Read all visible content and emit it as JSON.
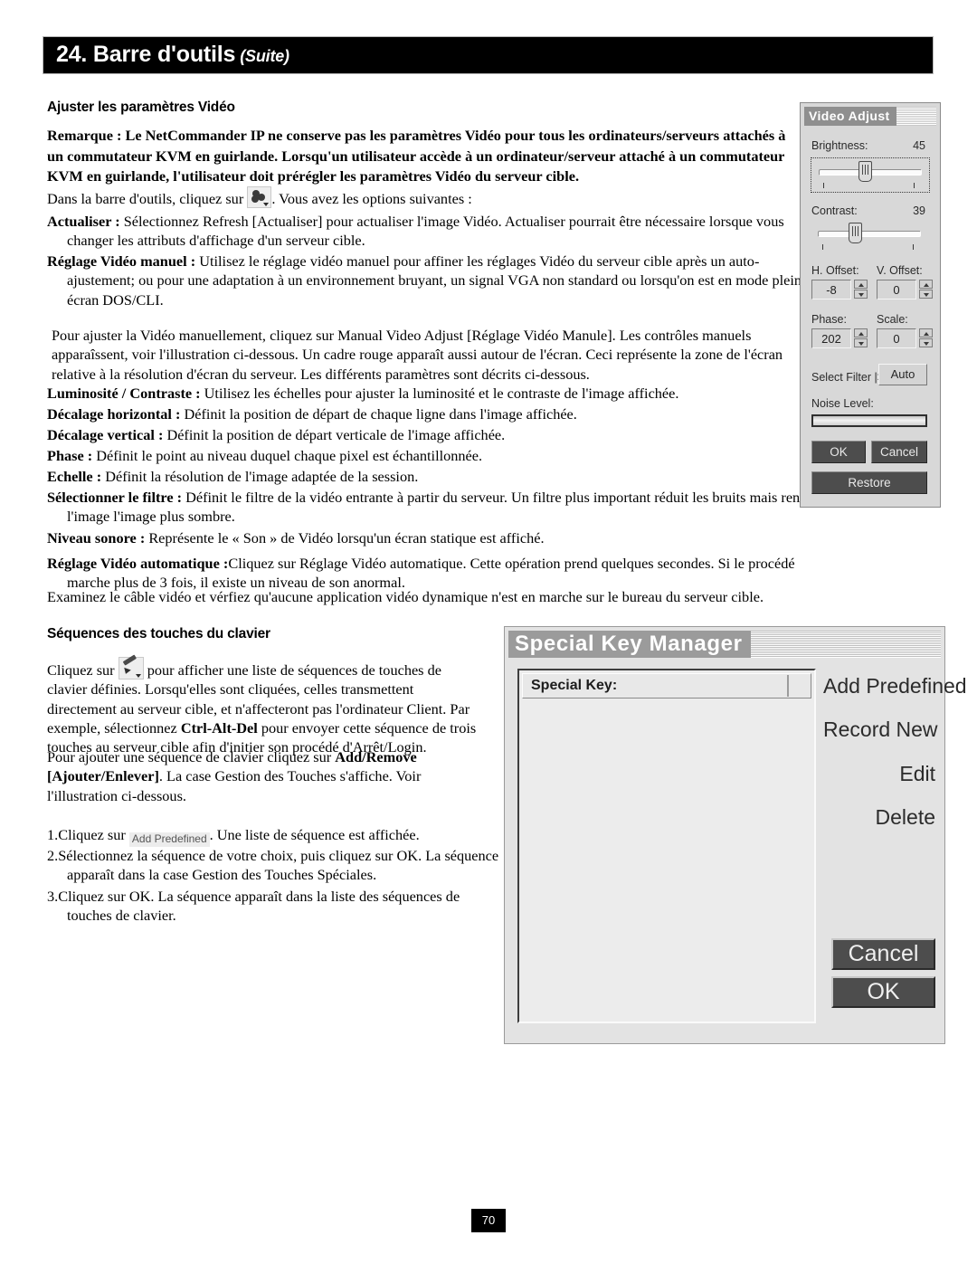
{
  "header": {
    "title": "24. Barre d'outils",
    "suffix": "(Suite)"
  },
  "sections": {
    "video_heading": "Ajuster les paramètres Vidéo",
    "note_label": "Remarque :",
    "note_body": " Le NetCommander IP ne conserve pas les paramètres Vidéo pour tous les ordinateurs/serveurs attachés à un commutateur KVM en guirlande. Lorsqu'un utilisateur accède à un ordinateur/serveur attaché à un commutateur KVM en guirlande, l'utilisateur doit prérégler les paramètres Vidéo du serveur cible.",
    "toolbar_line_pre": "Dans la barre d'outils, cliquez sur ",
    "toolbar_line_post": ". Vous avez les options suivantes :",
    "refresh_label": "Actualiser :",
    "refresh_body": " Sélectionnez Refresh [Actualiser] pour actualiser l'image Vidéo. Actualiser pourrait être nécessaire lorsque vous changer les attributs d'affichage d'un serveur cible.",
    "manual_label": "Réglage Vidéo manuel :",
    "manual_body": " Utilisez le réglage vidéo manuel pour affiner les réglages Vidéo du serveur cible après un auto-ajustement; ou pour une adaptation à un environnement bruyant, un signal VGA non standard ou lorsqu'on est en mode plein écran DOS/CLI.",
    "manual_intro": "Pour ajuster la Vidéo manuellement, cliquez sur Manual Video Adjust [Réglage Vidéo Manule]. Les contrôles manuels apparaîssent, voir l'illustration ci-dessous. Un cadre rouge apparaît aussi autour de l'écran. Ceci représente la zone de l'écran relative à la résolution d'écran du serveur. Les différents paramètres sont décrits ci-dessous.",
    "items": [
      {
        "label": "Luminosité / Contraste :",
        "body": " Utilisez les échelles pour ajuster la luminosité et le contraste de l'image affichée."
      },
      {
        "label": "Décalage horizontal :",
        "body": " Définit la position de départ de chaque ligne dans l'image affichée."
      },
      {
        "label": "Décalage vertical :",
        "body": " Définit la position de départ verticale de l'image affichée."
      },
      {
        "label": "Phase :",
        "body": " Définit le point au niveau duquel chaque pixel est échantillonnée."
      },
      {
        "label": "Echelle :",
        "body": " Définit la résolution de l'image adaptée de la session."
      },
      {
        "label": "Sélectionner le filtre :",
        "body": " Définit le filtre de la vidéo entrante à partir du serveur. Un filtre plus important réduit les bruits mais rend l'image l'image plus sombre."
      },
      {
        "label": "Niveau sonore :",
        "body": " Représente le « Son » de Vidéo lorsqu'un écran statique est affiché."
      },
      {
        "label": "Réglage Vidéo automatique :",
        "body": "Cliquez sur Réglage Vidéo automatique. Cette opération prend quelques secondes. Si le procédé marche plus de 3 fois, il existe un niveau de son anormal."
      }
    ],
    "closing_line": "Examinez le câble vidéo et vérfiez qu'aucune application vidéo dynamique n'est en marche sur le bureau du serveur cible.",
    "keys_heading": "Séquences des touches du clavier",
    "keys_para1_pre": "Cliquez sur ",
    "keys_para1_a": " pour afficher une liste de séquences de touches de clavier définies. Lorsqu'elles sont cliquées, celles transmettent directement au serveur cible, et n'affecteront pas l'ordinateur Client. Par exemple, sélectionnez ",
    "keys_para1_bold": "Ctrl-Alt-Del",
    "keys_para1_b": " pour envoyer cette séquence de trois touches au serveur cible afin d'initier son procédé d'Arrêt/Login.",
    "keys_para2_pre": "Pour ajouter une séquence de clavier cliquez sur ",
    "keys_para2_bold": "Add/Remove [Ajouter/Enlever]",
    "keys_para2_post": ". La case Gestion des Touches s'affiche. Voir l'illustration ci-dessous.",
    "steps": [
      {
        "num": "1.",
        "pre": "Cliquez sur ",
        "chip": "Add Predefined",
        "post": ". Une liste de séquence est affichée."
      },
      {
        "num": "2.",
        "pre": "",
        "chip": "",
        "post": "Sélectionnez la séquence de votre choix, puis cliquez sur OK. La séquence apparaît dans la case Gestion des Touches Spéciales."
      },
      {
        "num": "3.",
        "pre": "",
        "chip": "",
        "post": "Cliquez sur OK. La séquence apparaît dans la liste des séquences de touches de clavier."
      }
    ]
  },
  "video_adjust": {
    "title": "Video Adjust",
    "brightness_label": "Brightness:",
    "brightness_value": "45",
    "contrast_label": "Contrast:",
    "contrast_value": "39",
    "h_offset_label": "H. Offset:",
    "h_offset_value": "-8",
    "v_offset_label": "V. Offset:",
    "v_offset_value": "0",
    "phase_label": "Phase:",
    "phase_value": "202",
    "scale_label": "Scale:",
    "scale_value": "0",
    "select_filter_label": "Select Filter |>",
    "select_filter_value": "Auto",
    "noise_level_label": "Noise Level:",
    "ok_label": "OK",
    "cancel_label": "Cancel",
    "restore_label": "Restore"
  },
  "special_key_manager": {
    "title": "Special Key Manager",
    "list_header": "Special Key:",
    "actions": [
      "Add Predefined",
      "Record New",
      "Edit",
      "Delete"
    ],
    "cancel_label": "Cancel",
    "ok_label": "OK"
  },
  "footer": {
    "page_number": "70"
  }
}
